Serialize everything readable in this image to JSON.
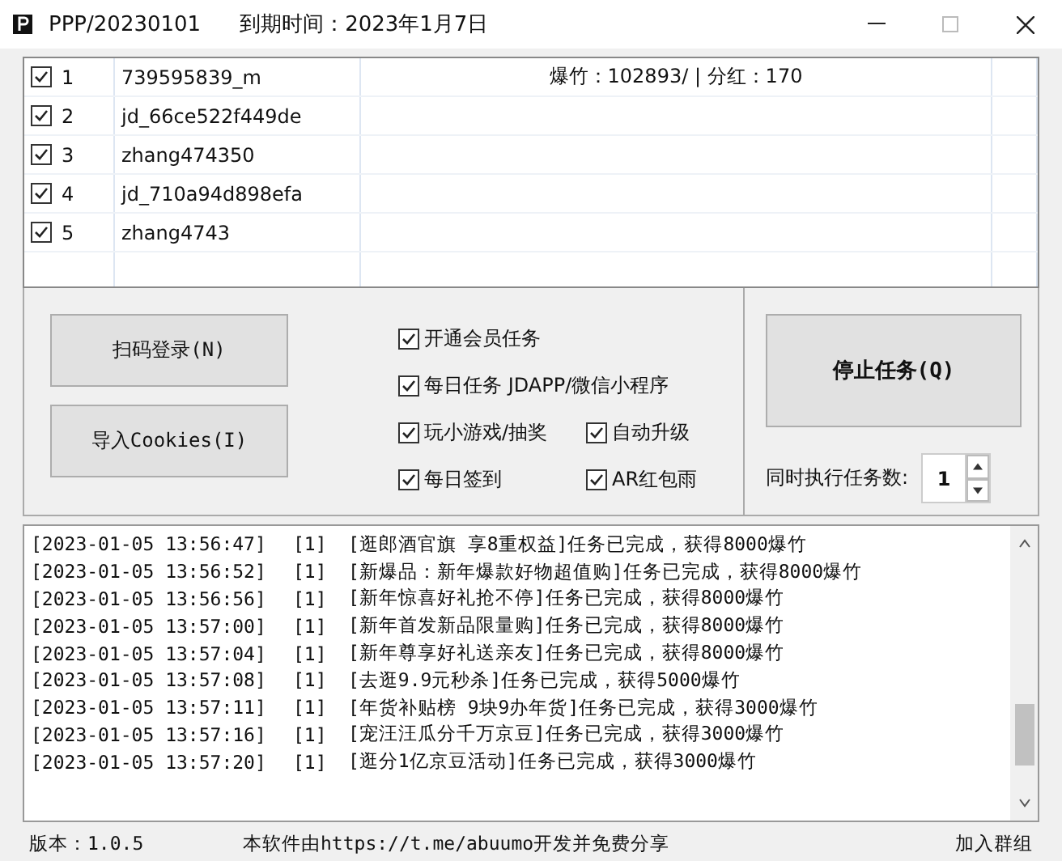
{
  "window": {
    "title": "PPP/20230101",
    "expiry": "到期时间：2023年1月7日"
  },
  "accounts": [
    {
      "checked": true,
      "index": "1",
      "name": "739595839_m",
      "info": "爆竹：102893/ | 分红：170"
    },
    {
      "checked": true,
      "index": "2",
      "name": "jd_66ce522f449de"
    },
    {
      "checked": true,
      "index": "3",
      "name": "zhang474350"
    },
    {
      "checked": true,
      "index": "4",
      "name": "jd_710a94d898efa"
    },
    {
      "checked": true,
      "index": "5",
      "name": "zhang4743"
    }
  ],
  "buttons": {
    "scan_login": "扫码登录(N)",
    "import_cookies": "导入Cookies(I)",
    "stop": "停止任务(Q)"
  },
  "options": [
    {
      "label": "开通会员任务",
      "checked": true
    },
    {
      "label": "每日任务 JDAPP/微信小程序",
      "checked": true
    },
    {
      "label": "玩小游戏/抽奖",
      "checked": true
    },
    {
      "label": "自动升级",
      "checked": true
    },
    {
      "label": "每日签到",
      "checked": true
    },
    {
      "label": "AR红包雨",
      "checked": true
    }
  ],
  "concurrency": {
    "label": "同时执行任务数:",
    "value": "1"
  },
  "log": [
    {
      "time": "[2023-01-05 13:56:47]",
      "account": "[1]",
      "message": "[逛郎酒官旗 享8重权益]任务已完成，获得8000爆竹"
    },
    {
      "time": "[2023-01-05 13:56:52]",
      "account": "[1]",
      "message": "[新爆品：新年爆款好物超值购]任务已完成，获得8000爆竹"
    },
    {
      "time": "[2023-01-05 13:56:56]",
      "account": "[1]",
      "message": "[新年惊喜好礼抢不停]任务已完成，获得8000爆竹"
    },
    {
      "time": "[2023-01-05 13:57:00]",
      "account": "[1]",
      "message": "[新年首发新品限量购]任务已完成，获得8000爆竹"
    },
    {
      "time": "[2023-01-05 13:57:04]",
      "account": "[1]",
      "message": "[新年尊享好礼送亲友]任务已完成，获得8000爆竹"
    },
    {
      "time": "[2023-01-05 13:57:08]",
      "account": "[1]",
      "message": "[去逛9.9元秒杀]任务已完成，获得5000爆竹"
    },
    {
      "time": "[2023-01-05 13:57:11]",
      "account": "[1]",
      "message": "[年货补贴榜 9块9办年货]任务已完成，获得3000爆竹"
    },
    {
      "time": "[2023-01-05 13:57:16]",
      "account": "[1]",
      "message": "[宠汪汪瓜分千万京豆]任务已完成，获得3000爆竹"
    },
    {
      "time": "[2023-01-05 13:57:20]",
      "account": "[1]",
      "message": "[逛分1亿京豆活动]任务已完成，获得3000爆竹"
    }
  ],
  "status_bar": {
    "version": "版本：1.0.5",
    "credit": "本软件由https://t.me/abuumo开发并免费分享",
    "join": "加入群组"
  }
}
